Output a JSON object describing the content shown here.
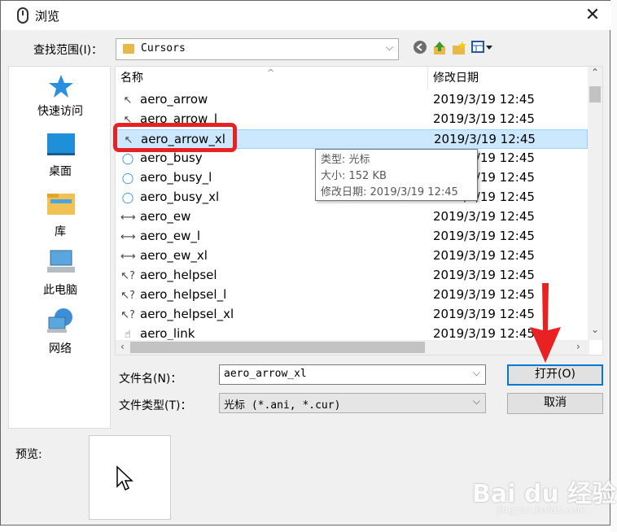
{
  "window": {
    "title": "浏览",
    "close_glyph": "✕"
  },
  "lookin": {
    "label": "查找范围(I)：",
    "value": "Cursors"
  },
  "toolbar": {
    "back_icon": "back-arrow-icon",
    "up_icon": "up-folder-icon",
    "new_folder_icon": "new-folder-icon",
    "view_menu_icon": "view-menu-icon"
  },
  "places": [
    {
      "label": "快速访问",
      "icon": "star-icon"
    },
    {
      "label": "桌面",
      "icon": "desktop-icon"
    },
    {
      "label": "库",
      "icon": "library-icon"
    },
    {
      "label": "此电脑",
      "icon": "computer-icon"
    },
    {
      "label": "网络",
      "icon": "network-icon"
    }
  ],
  "columns": {
    "name": "名称",
    "date": "修改日期"
  },
  "files": [
    {
      "name": "aero_arrow",
      "date": "2019/3/19 12:45",
      "icon": "arrow-cursor-icon",
      "glyph": "↖",
      "selected": false
    },
    {
      "name": "aero_arrow_l",
      "date": "2019/3/19 12:45",
      "icon": "arrow-cursor-icon",
      "glyph": "↖",
      "selected": false
    },
    {
      "name": "aero_arrow_xl",
      "date": "2019/3/19 12:45",
      "icon": "arrow-cursor-icon",
      "glyph": "↖",
      "selected": true
    },
    {
      "name": "aero_busy",
      "date": "2019/3/19 12:45",
      "icon": "busy-ring-icon",
      "glyph": "◯",
      "selected": false
    },
    {
      "name": "aero_busy_l",
      "date": "2019/3/19 12:45",
      "icon": "busy-ring-icon",
      "glyph": "◯",
      "selected": false
    },
    {
      "name": "aero_busy_xl",
      "date": "2019/3/19 12:45",
      "icon": "busy-ring-icon",
      "glyph": "◯",
      "selected": false
    },
    {
      "name": "aero_ew",
      "date": "2019/3/19 12:45",
      "icon": "ew-resize-icon",
      "glyph": "⟷",
      "selected": false
    },
    {
      "name": "aero_ew_l",
      "date": "2019/3/19 12:45",
      "icon": "ew-resize-icon",
      "glyph": "⟷",
      "selected": false
    },
    {
      "name": "aero_ew_xl",
      "date": "2019/3/19 12:45",
      "icon": "ew-resize-icon",
      "glyph": "⟷",
      "selected": false
    },
    {
      "name": "aero_helpsel",
      "date": "2019/3/19 12:45",
      "icon": "help-cursor-icon",
      "glyph": "↖?",
      "selected": false
    },
    {
      "name": "aero_helpsel_l",
      "date": "2019/3/19 12:45",
      "icon": "help-cursor-icon",
      "glyph": "↖?",
      "selected": false
    },
    {
      "name": "aero_helpsel_xl",
      "date": "2019/3/19 12:45",
      "icon": "help-cursor-icon",
      "glyph": "↖?",
      "selected": false
    },
    {
      "name": "aero_link",
      "date": "2019/3/19 12:45",
      "icon": "hand-cursor-icon",
      "glyph": "☝",
      "selected": false
    }
  ],
  "tooltip": {
    "line1": "类型: 光标",
    "line2": "大小: 152 KB",
    "line3": "修改日期: 2019/3/19 12:45"
  },
  "filename": {
    "label": "文件名(N)：",
    "value": "aero_arrow_xl"
  },
  "filetype": {
    "label": "文件类型(T)：",
    "value": "光标 (*.ani, *.cur)"
  },
  "buttons": {
    "open": "打开(O)",
    "cancel": "取消"
  },
  "preview": {
    "label": "预览:"
  },
  "watermark": {
    "text": "Bai du 经验",
    "sub": "jingyan.baidu.com"
  },
  "colors": {
    "selection": "#cce8ff",
    "highlight_red": "#e82222",
    "default_button_border": "#0078d7"
  }
}
